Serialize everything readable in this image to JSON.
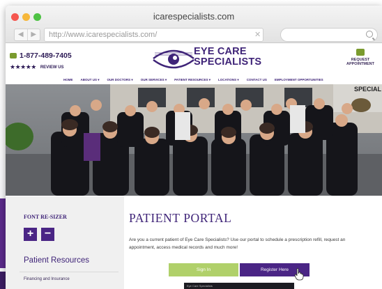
{
  "window": {
    "title": "icarespecialists.com",
    "url": "http://www.icarespecialists.com/"
  },
  "header": {
    "phone": "1-877-489-7405",
    "stars": "★★★★★",
    "review_label": "REVIEW US",
    "logo_line1": "EYE CARE",
    "logo_line2": "SPECIALISTS",
    "request_line1": "REQUEST",
    "request_line2": "APPOINTMENT"
  },
  "menu": [
    {
      "label": "HOME"
    },
    {
      "label": "ABOUT US ▾"
    },
    {
      "label": "OUR DOCTORS ▾"
    },
    {
      "label": "OUR SERVICES ▾"
    },
    {
      "label": "PATIENT RESOURCES ▾"
    },
    {
      "label": "LOCATIONS ▾"
    },
    {
      "label": "CONTACT US"
    },
    {
      "label": "EMPLOYMENT OPPORTUNITIES"
    }
  ],
  "hero": {
    "sign_text": "SPECIAL"
  },
  "sidebar": {
    "font_resizer_title": "FONT RE-SIZER",
    "plus": "+",
    "minus": "−",
    "patient_resources": "Patient Resources",
    "financing": "Financing and Insurance"
  },
  "content": {
    "title": "PATIENT PORTAL",
    "body": "Are you a current patient of Eye Care Specialists? Use our portal to schedule a prescription refill, request an appointment, access medical records and much more!",
    "signin_label": "Sign In",
    "register_label": "Register Here",
    "video_label": "Eye Care Specialists"
  },
  "colors": {
    "brand_purple": "#3f2478",
    "button_purple": "#4a2585",
    "button_green": "#b0d06a",
    "accent_green": "#7a9b2e"
  },
  "icons": [
    "phone-icon",
    "calendar-icon",
    "search-icon",
    "eye-logo-icon",
    "hand-cursor-icon"
  ]
}
